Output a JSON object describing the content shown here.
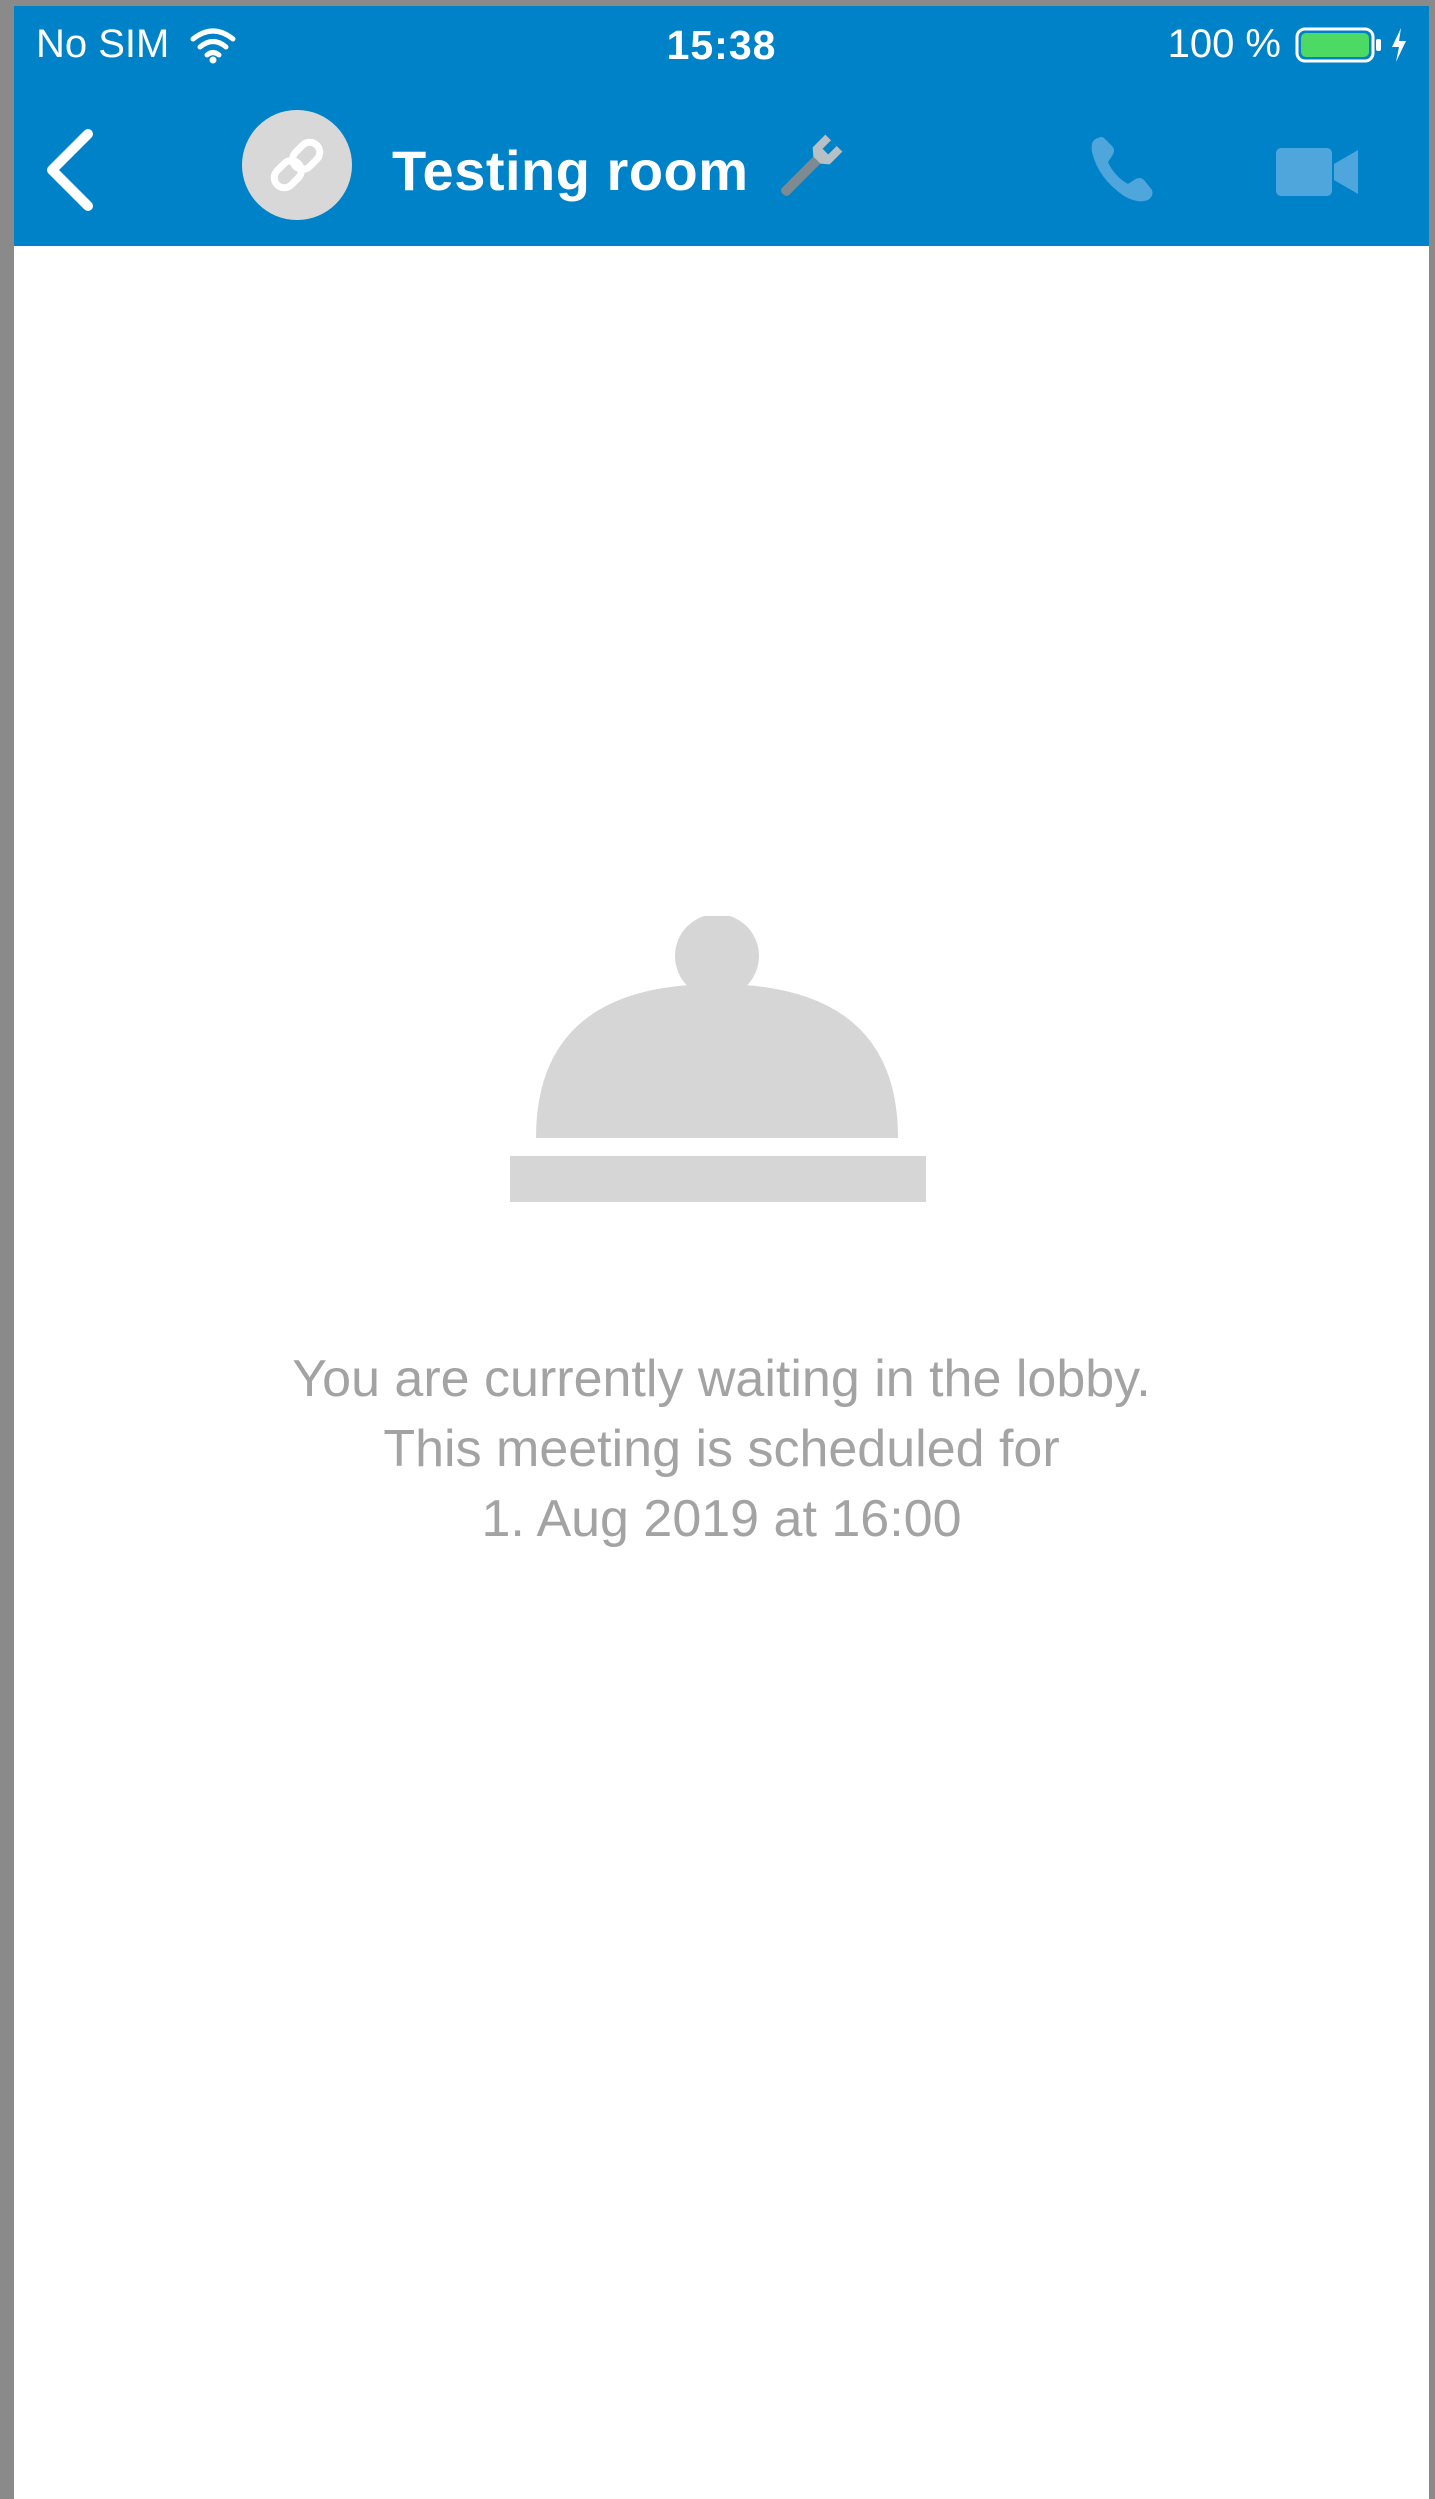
{
  "status_bar": {
    "carrier": "No SIM",
    "time": "15:38",
    "battery_percent": "100 %",
    "battery_level": 1.0
  },
  "header": {
    "title": "Testing room",
    "avatar_icon": "link-icon",
    "title_icon": "wrench-icon",
    "background_color": "#0082c9",
    "actions": [
      "call-icon",
      "video-icon"
    ]
  },
  "lobby": {
    "icon": "concierge-bell-icon",
    "message_line_1": "You are currently waiting in the lobby.",
    "message_line_2": "This meeting is scheduled for",
    "message_line_3": "1. Aug 2019 at 16:00"
  }
}
